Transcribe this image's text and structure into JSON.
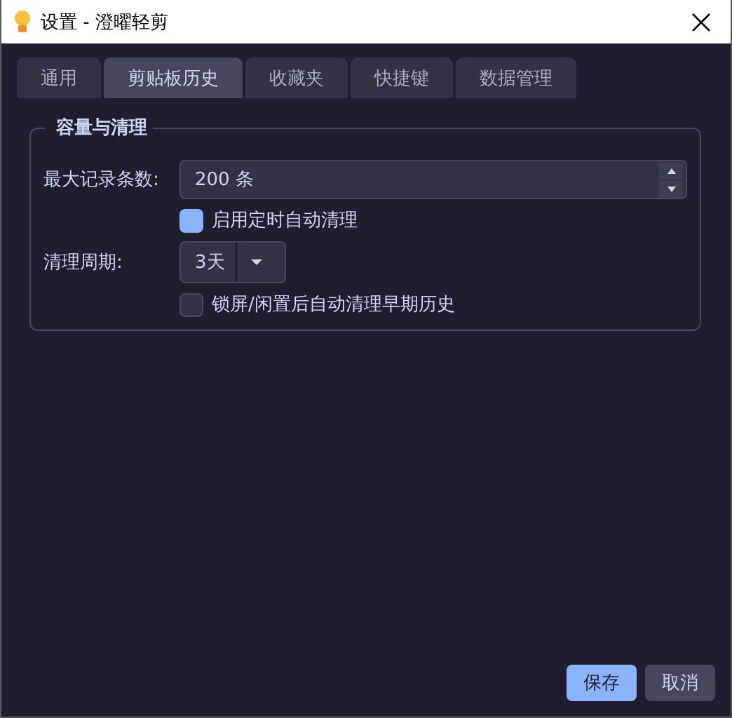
{
  "window": {
    "title": "设置 - 澄曜轻剪"
  },
  "tabs": [
    {
      "label": "通用",
      "selected": false
    },
    {
      "label": "剪贴板历史",
      "selected": true
    },
    {
      "label": "收藏夹",
      "selected": false
    },
    {
      "label": "快捷键",
      "selected": false
    },
    {
      "label": "数据管理",
      "selected": false
    }
  ],
  "group": {
    "title": "容量与清理",
    "rows": [
      {
        "kind": "spin",
        "label": "最大记录条数:",
        "value": "200 条"
      },
      {
        "kind": "checkbox",
        "label": "启用定时自动清理",
        "checked": true
      },
      {
        "kind": "combo",
        "label": "清理周期:",
        "value": "3天"
      },
      {
        "kind": "checkbox",
        "label": "锁屏/闲置后自动清理早期历史",
        "checked": false
      }
    ]
  },
  "buttons": [
    {
      "label": "保存",
      "kind": "primary"
    },
    {
      "label": "取消",
      "kind": "secondary"
    }
  ]
}
